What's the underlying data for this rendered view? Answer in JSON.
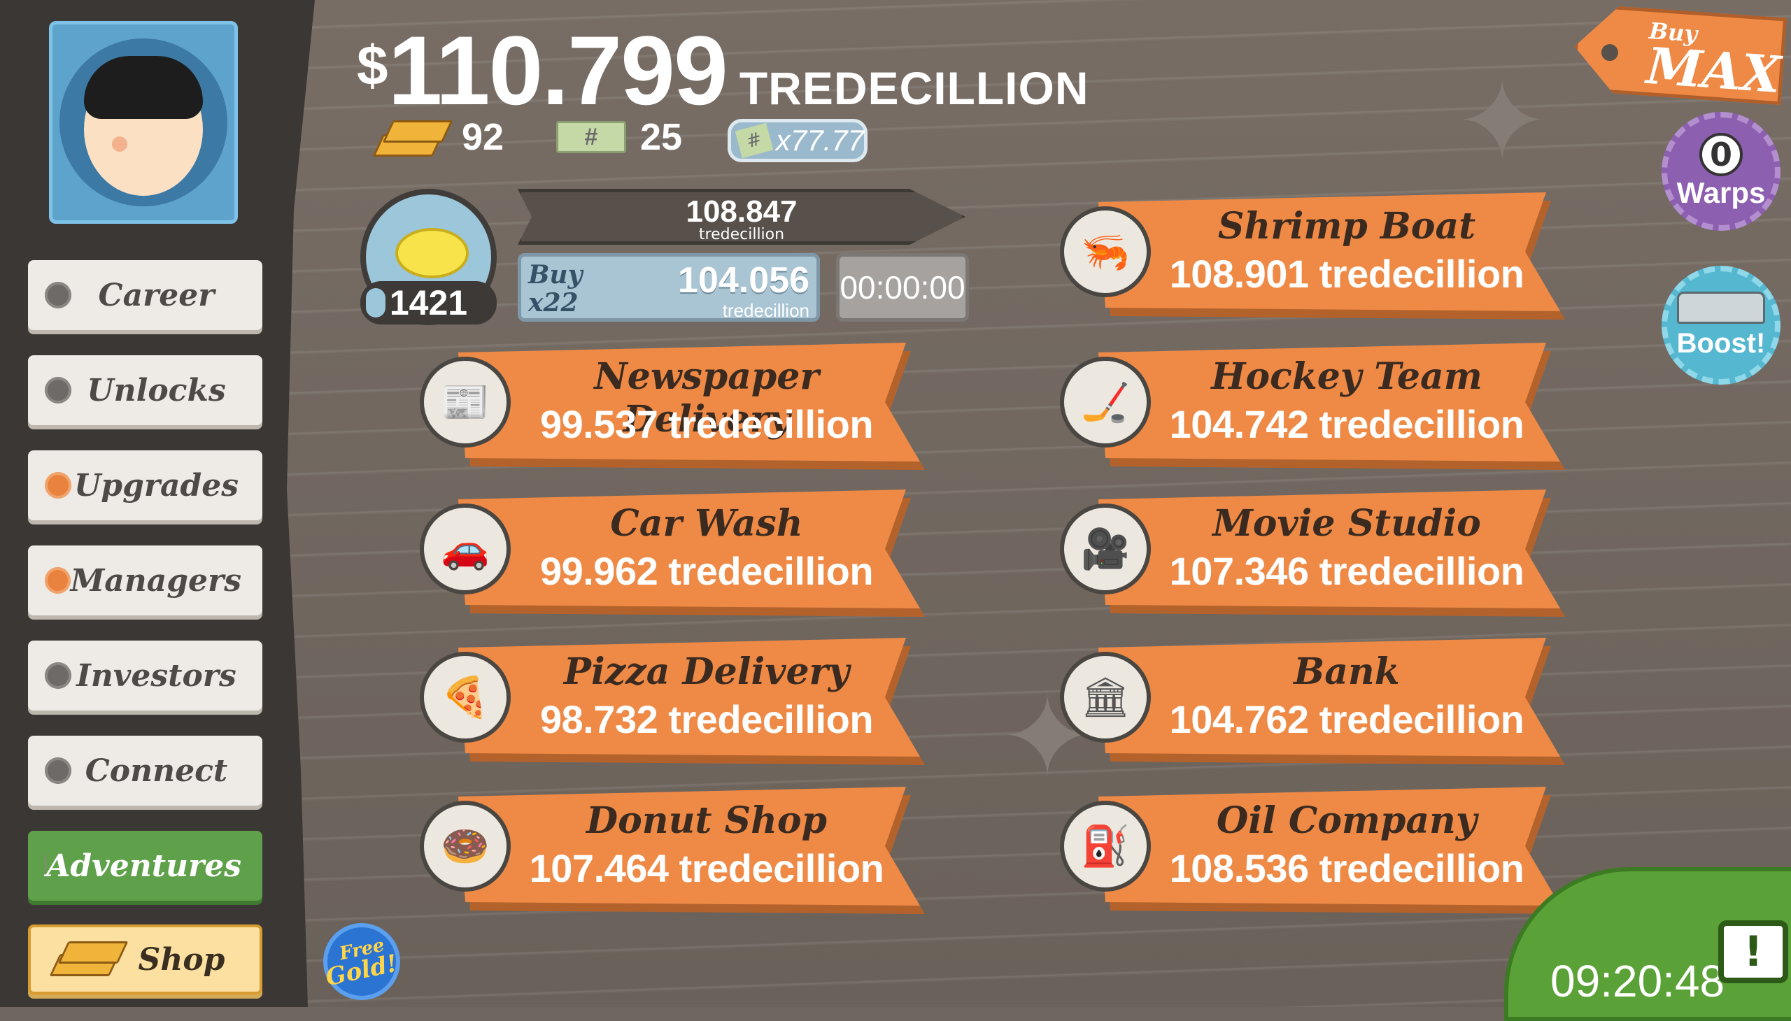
{
  "player": {
    "avatar": "astronaut-avatar"
  },
  "money": {
    "symbol": "$",
    "amount": "110.799",
    "unit": "TREDECILLION"
  },
  "stats": {
    "gold": "92",
    "tickets": "25",
    "multiplier": "x77.77"
  },
  "featured": {
    "count": "1421",
    "progress_value": "108.847",
    "progress_unit": "tredecillion",
    "buy_label": "Buy",
    "buy_qty": "x22",
    "buy_value": "104.056",
    "buy_unit": "tredecillion",
    "timer": "00:00:00"
  },
  "nav": [
    {
      "label": "Career"
    },
    {
      "label": "Unlocks"
    },
    {
      "label": "Upgrades"
    },
    {
      "label": "Managers"
    },
    {
      "label": "Investors"
    },
    {
      "label": "Connect"
    },
    {
      "label": "Adventures"
    },
    {
      "label": "Shop"
    }
  ],
  "free_gold": {
    "line1": "Free",
    "line2": "Gold!"
  },
  "businesses": [
    {
      "name": "Newspaper Delivery",
      "value": "99.537 tredecillion",
      "icon": "newspaper-icon"
    },
    {
      "name": "Car Wash",
      "value": "99.962 tredecillion",
      "icon": "car-icon"
    },
    {
      "name": "Pizza Delivery",
      "value": "98.732 tredecillion",
      "icon": "pizza-icon"
    },
    {
      "name": "Donut Shop",
      "value": "107.464 tredecillion",
      "icon": "donut-icon"
    },
    {
      "name": "Shrimp Boat",
      "value": "108.901 tredecillion",
      "icon": "shrimp-icon"
    },
    {
      "name": "Hockey Team",
      "value": "104.742 tredecillion",
      "icon": "hockey-icon"
    },
    {
      "name": "Movie Studio",
      "value": "107.346 tredecillion",
      "icon": "movie-camera-icon"
    },
    {
      "name": "Bank",
      "value": "104.762 tredecillion",
      "icon": "bank-icon"
    },
    {
      "name": "Oil Company",
      "value": "108.536 tredecillion",
      "icon": "oil-derrick-icon"
    }
  ],
  "buy_max": {
    "line1": "Buy",
    "line2": "MAX"
  },
  "warps": {
    "count": "0",
    "label": "Warps"
  },
  "boost": {
    "label": "Boost!"
  },
  "tv_timer": "09:20:48",
  "colors": {
    "banner": "#ee8a46",
    "sidebar": "#3b3734",
    "green": "#5fa14a",
    "dot_orange": "#e9823e"
  }
}
